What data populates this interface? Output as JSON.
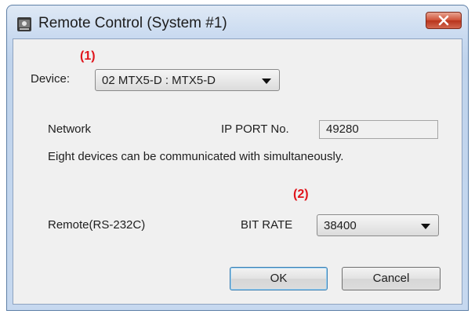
{
  "window": {
    "title": "Remote Control (System #1)"
  },
  "markers": {
    "device": "(1)",
    "bitrate": "(2)"
  },
  "device": {
    "label": "Device:",
    "value": "02 MTX5-D : MTX5-D"
  },
  "network": {
    "label": "Network",
    "ip_port_label": "IP PORT No.",
    "ip_port_value": "49280",
    "note": "Eight devices can be communicated with simultaneously."
  },
  "remote": {
    "label": "Remote(RS-232C)",
    "bitrate_label": "BIT RATE",
    "bitrate_value": "38400"
  },
  "buttons": {
    "ok": "OK",
    "cancel": "Cancel"
  }
}
